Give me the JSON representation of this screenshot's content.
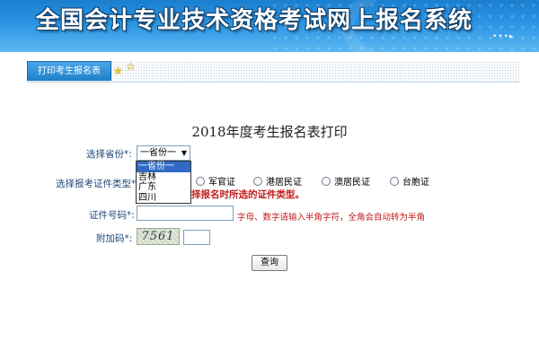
{
  "header": {
    "title": "全国会计专业技术资格考试网上报名系统",
    "decor": "•••▸"
  },
  "tabs": {
    "active_label": "打印考生报名表"
  },
  "form": {
    "title": "2018年度考生报名表打印",
    "province_label": "选择省份",
    "required_mark": "*:",
    "province_selected": "一省份一",
    "province_options": [
      "一省份一",
      "吉林",
      "广东",
      "四川"
    ],
    "id_type_label": "选择报考证件类型",
    "id_types": [
      "军官证",
      "港居民证",
      "澳居民证",
      "台胞证"
    ],
    "id_type_warning": "择报名时所选的证件类型。",
    "id_number_label": "证件号码",
    "id_number_value": "",
    "id_number_hint": "字母、数字请输入半角字符，全角会自动转为半角",
    "extra_code_label": "附加码",
    "captcha_text": "7561",
    "extra_code_value": "",
    "query_button": "查询"
  },
  "colors": {
    "banner": "#2b95e4",
    "tab": "#1e7fc9",
    "warning": "#c31b1b",
    "label": "#1f4a77",
    "dropdown_highlight": "#316ac5"
  }
}
